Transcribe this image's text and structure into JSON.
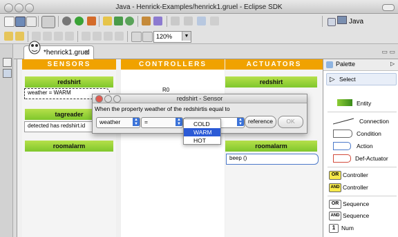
{
  "window": {
    "title": "Java - Henrick-Examples/henrick1.gruel - Eclipse SDK"
  },
  "toolbar": {
    "zoom_value": "120%",
    "perspective_label": "Java"
  },
  "editor": {
    "tab_label": "*henrick1.gruel",
    "tab_close": "⊠",
    "minmax": "▭ ▭"
  },
  "columns": {
    "sensors": "SENSORS",
    "controllers": "CONTROLLERS",
    "actuators": "ACTUATORS"
  },
  "sensors": {
    "redshirt": "redshirt",
    "weather_item": "weather = WARM",
    "tagreader": "tagreader",
    "detected_item": "detected has redshirt.id",
    "roomalarm": "roomalarm"
  },
  "controllers": {
    "r0": "R0"
  },
  "actuators": {
    "redshirt": "redshirt",
    "roomalarm": "roomalarm",
    "beep_item": "beep ()"
  },
  "dialog": {
    "title": "redshirt - Sensor",
    "question": "When the property weather of the redshirtis equal to",
    "property_combo": "weather",
    "operator_combo": "=",
    "reference_label": "reference",
    "ok_label": "OK",
    "options": [
      "COLD",
      "WARM",
      "HOT"
    ],
    "selected_option": "WARM"
  },
  "palette": {
    "title": "Palette",
    "select": "Select",
    "entity": "Entity",
    "connection": "Connection",
    "condition": "Condition",
    "action": "Action",
    "def_actuator": "Def-Actuator",
    "controller_or": "Controller",
    "controller_and": "Controller",
    "sequence_or": "Sequence",
    "sequence_and": "Sequence",
    "num": "Num",
    "badge_or": "OR",
    "badge_and": "AND",
    "badge_num": "1"
  },
  "colors": {
    "column_header": "#f0a200",
    "entity_bar": "#8ccc35",
    "selection": "#2b5ad6",
    "dialog_bg": "#e8e8e8"
  }
}
